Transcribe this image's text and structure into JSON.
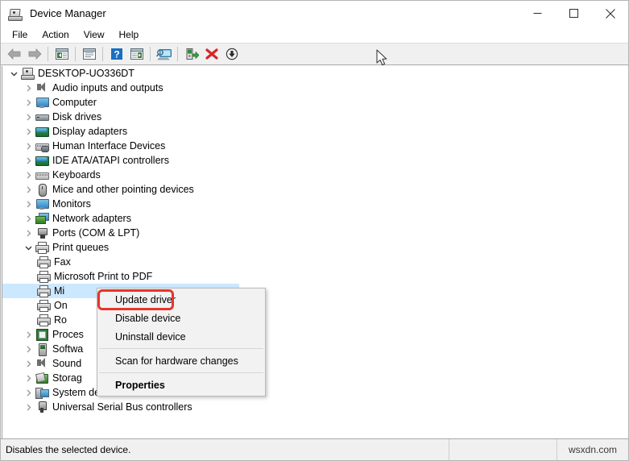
{
  "window": {
    "title": "Device Manager",
    "icon": "device-manager-icon",
    "controls": {
      "minimize": "Minimize",
      "maximize": "Maximize",
      "close": "Close"
    }
  },
  "menubar": {
    "items": [
      {
        "label": "File"
      },
      {
        "label": "Action"
      },
      {
        "label": "View"
      },
      {
        "label": "Help"
      }
    ]
  },
  "toolbar": {
    "buttons": [
      {
        "name": "back-button",
        "icon": "left-arrow-icon",
        "label": "Back"
      },
      {
        "name": "forward-button",
        "icon": "right-arrow-icon",
        "label": "Forward"
      },
      {
        "name": "show-hide-console-tree-button",
        "icon": "console-tree-icon",
        "label": "Show/Hide Console Tree"
      },
      {
        "name": "properties-button",
        "icon": "properties-window-icon",
        "label": "Properties"
      },
      {
        "name": "help-button",
        "icon": "question-mark-icon",
        "label": "Help"
      },
      {
        "name": "show-hide-action-pane-button",
        "icon": "action-pane-icon",
        "label": "Show/Hide Action Pane"
      },
      {
        "name": "scan-hardware-changes-button",
        "icon": "scan-monitor-icon",
        "label": "Scan for hardware changes"
      },
      {
        "name": "update-driver-button",
        "icon": "green-driver-icon",
        "label": "Update driver"
      },
      {
        "name": "uninstall-device-button",
        "icon": "red-x-icon",
        "label": "Uninstall device"
      },
      {
        "name": "disable-device-button",
        "icon": "down-arrow-circle-icon",
        "label": "Disable device"
      }
    ]
  },
  "tree": {
    "nodes": [
      {
        "label": "DESKTOP-UO336DT",
        "depth": 0,
        "state": "expanded",
        "icon": "computer-root-icon",
        "selected": false
      },
      {
        "label": "Audio inputs and outputs",
        "depth": 1,
        "state": "collapsed",
        "icon": "speaker-icon",
        "selected": false
      },
      {
        "label": "Computer",
        "depth": 1,
        "state": "collapsed",
        "icon": "monitor-icon",
        "selected": false
      },
      {
        "label": "Disk drives",
        "depth": 1,
        "state": "collapsed",
        "icon": "disk-drive-icon",
        "selected": false
      },
      {
        "label": "Display adapters",
        "depth": 1,
        "state": "collapsed",
        "icon": "display-adapter-icon",
        "selected": false
      },
      {
        "label": "Human Interface Devices",
        "depth": 1,
        "state": "collapsed",
        "icon": "hid-icon",
        "selected": false
      },
      {
        "label": "IDE ATA/ATAPI controllers",
        "depth": 1,
        "state": "collapsed",
        "icon": "ide-controller-icon",
        "selected": false
      },
      {
        "label": "Keyboards",
        "depth": 1,
        "state": "collapsed",
        "icon": "keyboard-icon",
        "selected": false
      },
      {
        "label": "Mice and other pointing devices",
        "depth": 1,
        "state": "collapsed",
        "icon": "mouse-icon",
        "selected": false
      },
      {
        "label": "Monitors",
        "depth": 1,
        "state": "collapsed",
        "icon": "monitor-icon",
        "selected": false
      },
      {
        "label": "Network adapters",
        "depth": 1,
        "state": "collapsed",
        "icon": "network-adapter-icon",
        "selected": false
      },
      {
        "label": "Ports (COM & LPT)",
        "depth": 1,
        "state": "collapsed",
        "icon": "port-icon",
        "selected": false
      },
      {
        "label": "Print queues",
        "depth": 1,
        "state": "expanded",
        "icon": "printer-icon",
        "selected": false
      },
      {
        "label": "Fax",
        "depth": 2,
        "state": "leaf",
        "icon": "printer-icon",
        "selected": false
      },
      {
        "label": "Microsoft Print to PDF",
        "depth": 2,
        "state": "leaf",
        "icon": "printer-icon",
        "selected": false
      },
      {
        "label": "Mi",
        "depth": 2,
        "state": "leaf",
        "icon": "printer-icon",
        "selected": true
      },
      {
        "label": "On",
        "depth": 2,
        "state": "leaf",
        "icon": "printer-icon",
        "selected": false
      },
      {
        "label": "Ro",
        "depth": 2,
        "state": "leaf",
        "icon": "printer-icon",
        "selected": false
      },
      {
        "label": "Proces",
        "depth": 1,
        "state": "collapsed",
        "icon": "processor-icon",
        "selected": false
      },
      {
        "label": "Softwa",
        "depth": 1,
        "state": "collapsed",
        "icon": "software-device-icon",
        "selected": false
      },
      {
        "label": "Sound",
        "depth": 1,
        "state": "collapsed",
        "icon": "speaker-icon",
        "selected": false
      },
      {
        "label": "Storag",
        "depth": 1,
        "state": "collapsed",
        "icon": "storage-controller-icon",
        "selected": false
      },
      {
        "label": "System devices",
        "depth": 1,
        "state": "collapsed",
        "icon": "system-device-icon",
        "selected": false
      },
      {
        "label": "Universal Serial Bus controllers",
        "depth": 1,
        "state": "collapsed",
        "icon": "usb-icon",
        "selected": false
      }
    ]
  },
  "context_menu": {
    "items": [
      {
        "label": "Update driver",
        "type": "item",
        "bold": false,
        "highlighted": true
      },
      {
        "label": "Disable device",
        "type": "item",
        "bold": false,
        "highlighted": false
      },
      {
        "label": "Uninstall device",
        "type": "item",
        "bold": false,
        "highlighted": false
      },
      {
        "type": "separator"
      },
      {
        "label": "Scan for hardware changes",
        "type": "item",
        "bold": false,
        "highlighted": false
      },
      {
        "type": "separator"
      },
      {
        "label": "Properties",
        "type": "item",
        "bold": true,
        "highlighted": false
      }
    ]
  },
  "statusbar": {
    "message": "Disables the selected device.",
    "pane2": "",
    "watermark": "wsxdn.com"
  },
  "colors": {
    "highlight_box": "#e8352b",
    "selection": "#cce8ff",
    "toolbar_bg": "#f0f0f0",
    "menu_bg": "#f2f2f2"
  }
}
